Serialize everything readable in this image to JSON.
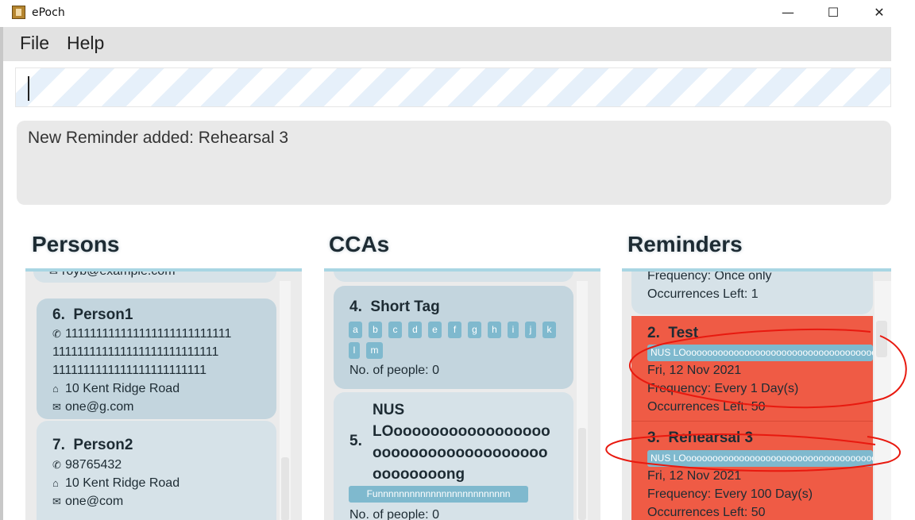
{
  "window": {
    "title": "ePoch",
    "minimize_icon": "minimize-icon",
    "maximize_icon": "maximize-icon",
    "close_icon": "close-icon"
  },
  "menu": {
    "file": "File",
    "help": "Help"
  },
  "command": {
    "value": ""
  },
  "result": {
    "message": "New Reminder added: Rehearsal 3"
  },
  "panels": {
    "persons": {
      "title": "Persons",
      "partial_email": "royb@example.com",
      "items": [
        {
          "index": "6.",
          "name": "Person1",
          "phone_lines": [
            "111111111111111111111111111",
            "111111111111111111111111111",
            "1111111111111111111111111"
          ],
          "address": "10 Kent Ridge Road",
          "email": "one@g.com"
        },
        {
          "index": "7.",
          "name": "Person2",
          "phone": "98765432",
          "address": "10 Kent Ridge Road",
          "email": "one@com"
        }
      ]
    },
    "ccas": {
      "title": "CCAs",
      "items": [
        {
          "index": "4.",
          "name": "Short Tag",
          "tags": [
            "a",
            "b",
            "c",
            "d",
            "e",
            "f",
            "g",
            "h",
            "i",
            "j",
            "k",
            "l",
            "m"
          ],
          "people": "No. of people: 0"
        },
        {
          "index": "5.",
          "name_lines": [
            "NUS",
            "LOooooooooooooooooo",
            "ooooooooooooooooooo",
            "oooooooong"
          ],
          "tags": [
            "Funnnnnnnnnnnnnnnnnnnnnnnnn"
          ],
          "people": "No. of people: 0"
        }
      ]
    },
    "reminders": {
      "title": "Reminders",
      "partial_frequency": "Frequency: Once only",
      "partial_occurrences": "Occurrences Left: 1",
      "items": [
        {
          "index": "2.",
          "name": "Test",
          "tag": "NUS LOooooooooooooooooooooooooooooooooooooo",
          "date": "Fri, 12 Nov 2021",
          "frequency": "Frequency: Every 1 Day(s)",
          "occurrences": "Occurrences Left: 50"
        },
        {
          "index": "3.",
          "name": "Rehearsal 3",
          "tag": "NUS LOooooooooooooooooooooooooooooooooooooo",
          "date": "Fri, 12 Nov 2021",
          "frequency": "Frequency: Every 100 Day(s)",
          "occurrences": "Occurrences Left: 50"
        }
      ]
    }
  },
  "colors": {
    "card_blue": "#c3d5de",
    "card_light": "#d6e2e8",
    "reminder_red": "#ef5b45",
    "tag_blue": "#7fb9ce",
    "annotation_red": "#e8190f"
  }
}
